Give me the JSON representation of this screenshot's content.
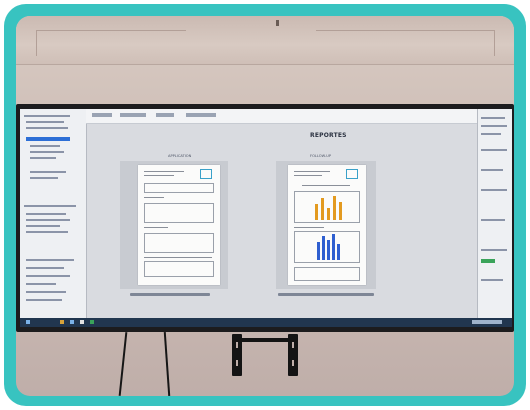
{
  "screen": {
    "report_heading": "REPORTES",
    "left_sheet_label": "APPLICATION",
    "right_sheet_label": "FOLLOW-UP"
  },
  "colors": {
    "frame": "#38c3c0",
    "wall": "#cdbdb6",
    "monitor_bezel": "#1c1c1e",
    "chart_orange": "#e39a1f",
    "chart_blue": "#2f5fd0"
  }
}
